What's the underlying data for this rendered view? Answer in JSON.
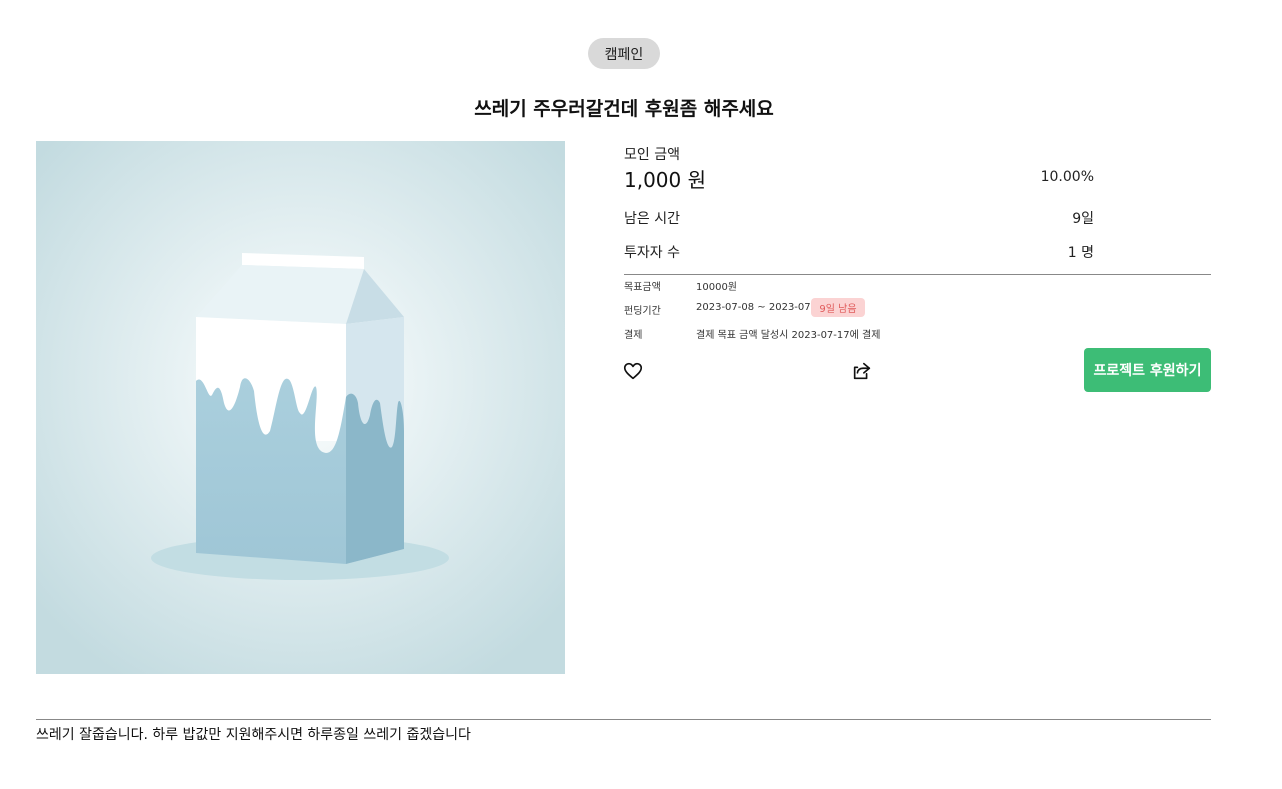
{
  "category": {
    "label": "캠페인"
  },
  "project": {
    "title": "쓰레기 주우러갈건데 후원좀 해주세요",
    "description": "쓰레기 잘줍습니다. 하루 밥값만 지원해주시면 하루종일 쓰레기 줍겠습니다"
  },
  "stats": {
    "raised_label": "모인 금액",
    "raised_value": "1,000 원",
    "percent": "10.00%",
    "remaining_label": "남은 시간",
    "remaining_value": "9일",
    "investors_label": "투자자 수",
    "investors_value": "1 명"
  },
  "details": {
    "goal_label": "목표금액",
    "goal_value": "10000원",
    "period_label": "펀딩기간",
    "period_value": "2023-07-08 ~ 2023-07-17",
    "days_left_badge": "9일 남음",
    "payment_label": "결제",
    "payment_value": "결제 목표 금액 달성시 2023-07-17에 결제"
  },
  "actions": {
    "like_icon": "heart-icon",
    "share_icon": "share-icon",
    "support_label": "프로젝트 후원하기"
  },
  "colors": {
    "accent": "#3dbd76",
    "badge_bg": "#fbd3d3",
    "badge_text": "#e05a5a",
    "category_bg": "#d9d9d9"
  }
}
